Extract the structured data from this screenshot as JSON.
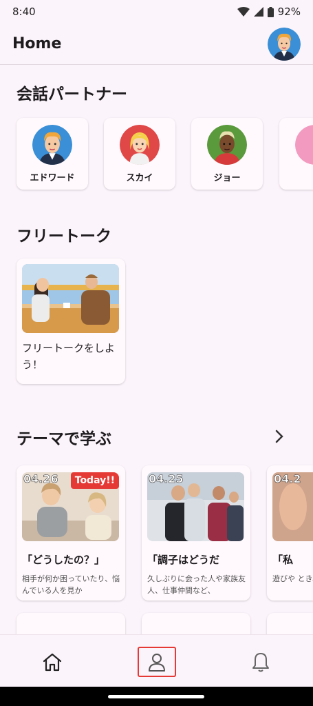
{
  "status_bar": {
    "time": "8:40",
    "battery": "92%"
  },
  "app_bar": {
    "title": "Home"
  },
  "partners": {
    "title": "会話パートナー",
    "items": [
      {
        "name": "エドワード"
      },
      {
        "name": "スカイ"
      },
      {
        "name": "ジョー"
      }
    ]
  },
  "free_talk": {
    "title": "フリートーク",
    "card_text": "フリートークをしよう！"
  },
  "themes": {
    "title": "テーマで学ぶ",
    "items": [
      {
        "date": "04.26",
        "badge": "Today!!",
        "title": "「どうしたの？」",
        "desc": "相手が何か困っていたり、悩んでいる人を見か"
      },
      {
        "date": "04.25",
        "title": "「調子はどうだ",
        "desc": "久しぶりに会った人や家族友人、仕事仲間など、"
      },
      {
        "date": "04.2",
        "title": "「私",
        "desc": "遊びや とき、"
      }
    ]
  },
  "nav": {
    "items": [
      "home-icon",
      "person-icon",
      "bell-icon"
    ]
  },
  "colors": {
    "background": "#fcf4fb",
    "accent": "#e53935"
  }
}
